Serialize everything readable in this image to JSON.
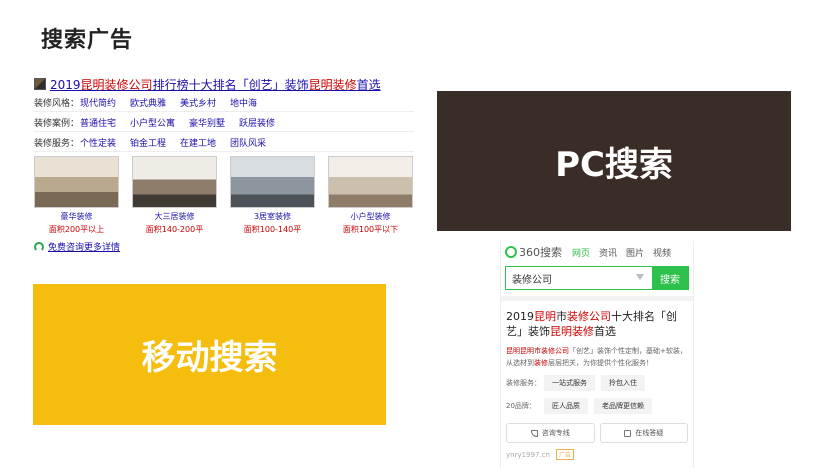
{
  "page_title": "搜索广告",
  "pc": {
    "title_pre": "2019",
    "title_hl": "昆明装修公司",
    "title_mid": "排行榜十大排名「创艺」装饰",
    "title_hl2": "昆明装修",
    "title_post": "首选",
    "rows": [
      {
        "label": "装修风格：",
        "values": [
          "现代简约",
          "欧式典雅",
          "美式乡村",
          "地中海"
        ]
      },
      {
        "label": "装修案例：",
        "values": [
          "普通住宅",
          "小户型公寓",
          "豪华别墅",
          "跃层装修"
        ]
      },
      {
        "label": "装修服务：",
        "values": [
          "个性定装",
          "铂金工程",
          "在建工地",
          "团队风采"
        ]
      }
    ],
    "thumbs": [
      {
        "cap1": "豪华装修",
        "cap2": "面积200平以上"
      },
      {
        "cap1": "大三居装修",
        "cap2": "面积140-200平"
      },
      {
        "cap1": "3居室装修",
        "cap2": "面积100-140平"
      },
      {
        "cap1": "小户型装修",
        "cap2": "面积100平以下"
      }
    ],
    "consult": "免费咨询更多详情"
  },
  "pc_label": "PC搜索",
  "mobile_label": "移动搜索",
  "mobile": {
    "logo": "360搜索",
    "tabs": [
      "网页",
      "资讯",
      "图片",
      "视频"
    ],
    "query": "装修公司",
    "search_btn": "搜索",
    "title_pre": "2019",
    "title_hl1": "昆明",
    "title_mid": "市",
    "title_hl2": "装修公司",
    "title_mid2": "十大排名「创艺」装饰",
    "title_hl3": "昆明装修",
    "title_post": "首选",
    "desc_hl": "昆明昆明市装修公司",
    "desc_mid": "「创艺」装饰个性定制，基础+软装，从选材到",
    "desc_hl2": "装修",
    "desc_post": "层层把关，为你提供个性化服务！",
    "service_label": "装修服务：",
    "service_chips": [
      "一站式服务",
      "拎包入住"
    ],
    "brand_label": "20品牌：",
    "brand_chips": [
      "匠人品质",
      "老品牌更信赖"
    ],
    "btn_consult": "咨询专线",
    "btn_online": "在线答疑",
    "footer_url": "ynry1997.cn",
    "footer_ad": "广告"
  }
}
